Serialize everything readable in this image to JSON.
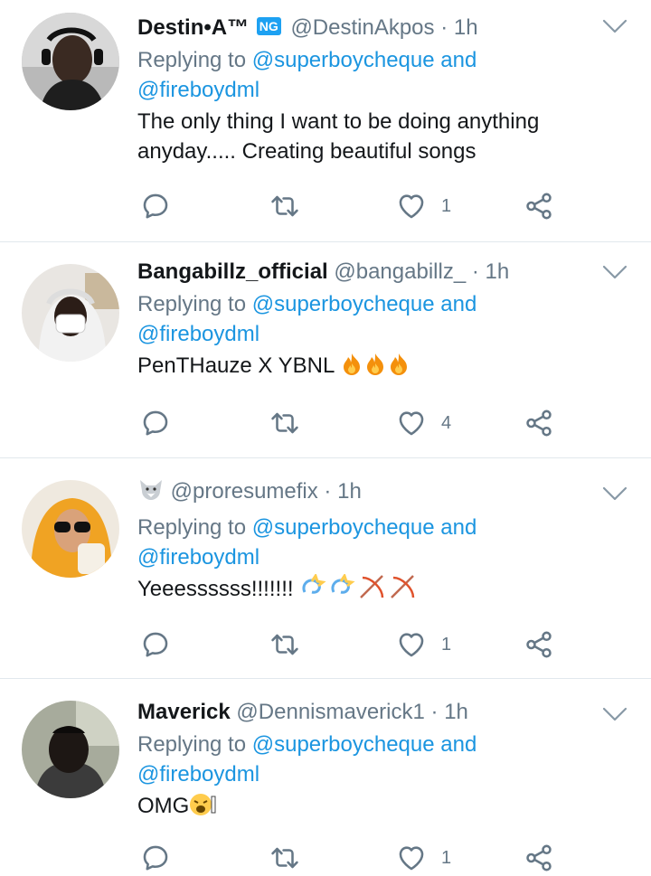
{
  "tweets": [
    {
      "name": "Destin•A™",
      "flag": "NG",
      "handle": "@DestinAkpos",
      "dot": "·",
      "time": "1h",
      "reply_prefix": "Replying to",
      "reply_user1": "@superboycheque",
      "reply_and": "and",
      "reply_user2": "@fireboydml",
      "text_line1": "The only thing I want to be doing anything",
      "text_line2": "anyday..... Creating beautiful songs",
      "likes": "1"
    },
    {
      "name": "Bangabillz_official",
      "handle": "@bangabillz_",
      "dot": "·",
      "time": "1h",
      "reply_prefix": "Replying to",
      "reply_user1": "@superboycheque",
      "reply_and": "and",
      "reply_user2": "@fireboydml",
      "text": "PenTHauze X YBNL",
      "likes": "4"
    },
    {
      "name": "",
      "handle": "@proresumefix",
      "dot": "·",
      "time": "1h",
      "reply_prefix": "Replying to",
      "reply_user1": "@superboycheque",
      "reply_and": "and",
      "reply_user2": "@fireboydml",
      "text": "Yeeessssss!!!!!!!",
      "likes": "1"
    },
    {
      "name": "Maverick",
      "handle": "@Dennismaverick1",
      "dot": "·",
      "time": "1h",
      "reply_prefix": "Replying to",
      "reply_user1": "@superboycheque",
      "reply_and": "and",
      "reply_user2": "@fireboydml",
      "text": "OMG",
      "likes": "1"
    }
  ],
  "icons": [
    "reply-icon",
    "retweet-icon",
    "like-icon",
    "share-icon",
    "chevron-down-icon"
  ],
  "colors": {
    "link": "#1b95e0",
    "muted": "#657786",
    "divider": "#e1e8ed"
  }
}
